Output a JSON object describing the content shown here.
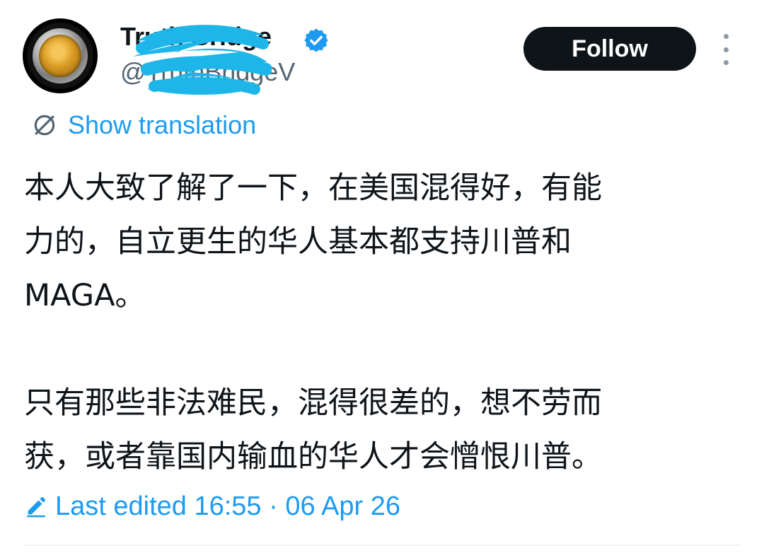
{
  "header": {
    "display_name": "Truth Bridge",
    "handle": "@TruthBridgeV",
    "follow_label": "Follow"
  },
  "translation": {
    "label": "Show translation"
  },
  "tweet": {
    "paragraph1": "本人大致了解了一下，在美国混得好，有能\n力的，自立更生的华人基本都支持川普和\nMAGA。",
    "paragraph2": "只有那些非法难民，混得很差的，想不劳而\n获，或者靠国内输血的华人才会憎恨川普。"
  },
  "edit_info": {
    "label": "Last edited 16:55 · 06 Apr 26"
  },
  "colors": {
    "text": "#0f1419",
    "secondary": "#536471",
    "accent": "#1d9bf0",
    "button_bg": "#0f1419",
    "redaction": "#1eb6e8"
  },
  "icons": {
    "verified": "verified-badge-icon",
    "translate": "translate-icon",
    "edited": "pencil-icon",
    "more": "more-vertical-icon"
  }
}
